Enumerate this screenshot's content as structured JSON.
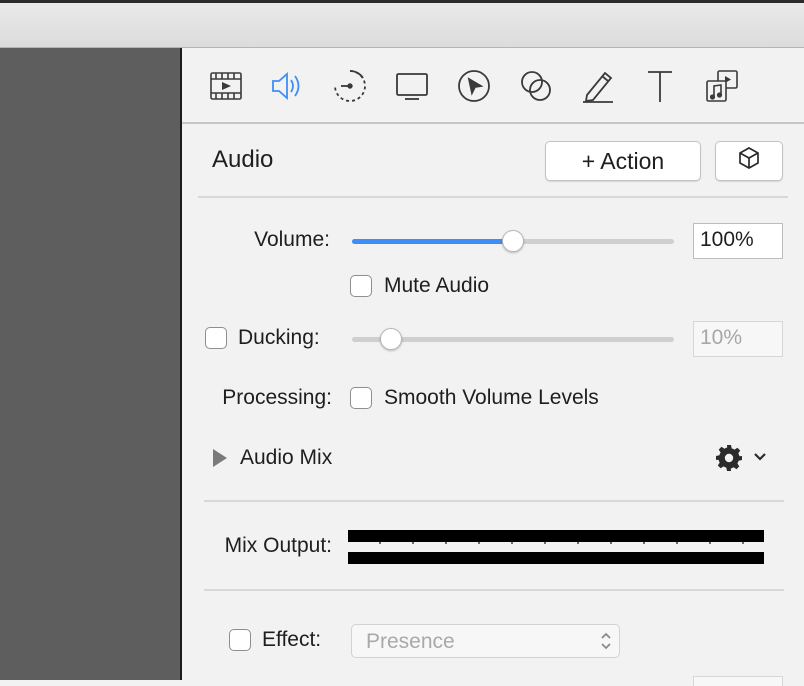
{
  "toolbar": {
    "tools": [
      {
        "icon": "video-clip-icon",
        "active": false
      },
      {
        "icon": "audio-speaker-icon",
        "active": true
      },
      {
        "icon": "animation-timer-icon",
        "active": false
      },
      {
        "icon": "screen-monitor-icon",
        "active": false
      },
      {
        "icon": "cursor-icon",
        "active": false
      },
      {
        "icon": "overlapping-circles-icon",
        "active": false
      },
      {
        "icon": "pencil-annotation-icon",
        "active": false
      },
      {
        "icon": "text-icon",
        "active": false
      },
      {
        "icon": "music-clip-icon",
        "active": false
      }
    ],
    "active_color": "#3f8ef5"
  },
  "section": {
    "title": "Audio",
    "action_button": "+ Action",
    "cube_icon": "cube-icon"
  },
  "volume": {
    "label": "Volume:",
    "value_text": "100%",
    "slider_fraction": 0.5
  },
  "mute": {
    "label": "Mute Audio",
    "checked": false
  },
  "ducking": {
    "label": "Ducking:",
    "checked": false,
    "value_text": "10%",
    "slider_fraction": 0.12
  },
  "processing": {
    "label": "Processing:",
    "checkbox_label": "Smooth Volume Levels",
    "checked": false
  },
  "audio_mix": {
    "label": "Audio Mix",
    "gear_icon": "gear-icon",
    "chevron_icon": "chevron-down-icon"
  },
  "mix_output": {
    "label": "Mix Output:"
  },
  "effect": {
    "label": "Effect:",
    "checked": false,
    "selected": "Presence"
  }
}
